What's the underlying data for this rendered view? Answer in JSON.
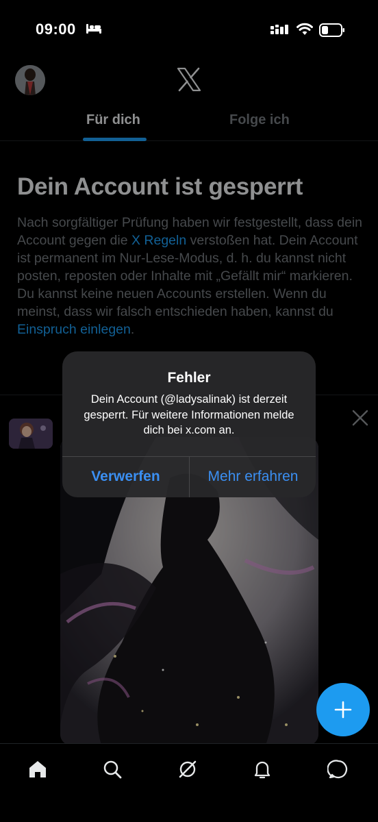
{
  "status_bar": {
    "time": "09:00",
    "sleep_icon": "bed-icon",
    "signal_icon": "cellular-signal-icon",
    "wifi_icon": "wifi-icon",
    "battery_icon": "battery-low-icon"
  },
  "header": {
    "logo_icon": "x-logo-icon",
    "tabs": [
      {
        "label": "Für dich",
        "active": true
      },
      {
        "label": "Folge ich",
        "active": false
      }
    ]
  },
  "notice": {
    "title": "Dein Account ist gesperrt",
    "body_part1": "Nach sorgfältiger Prüfung haben wir festgestellt, dass dein Account gegen die ",
    "rules_link": "X Regeln",
    "body_part2": " verstoßen hat. Dein Account ist permanent im Nur-Lese-Modus, d. h. du kannst nicht posten, reposten oder Inhalte mit „Gefällt mir“ markieren. Du kannst keine neuen Accounts erstellen. Wenn du meinst, dass wir falsch entschieden haben, kannst du ",
    "appeal_link": "Einspruch einlegen",
    "body_end": "."
  },
  "alert": {
    "title": "Fehler",
    "message": "Dein Account (@ladysalinak) ist derzeit gesperrt. Für weitere Informationen melde dich bei x.com an.",
    "dismiss_label": "Verwerfen",
    "learn_more_label": "Mehr erfahren"
  },
  "bottom_nav": {
    "items": [
      "home-icon",
      "search-icon",
      "grok-icon",
      "notifications-bell-icon",
      "messages-icon"
    ]
  },
  "colors": {
    "accent": "#1d9bf0",
    "alert_button": "#3b8ff2",
    "muted_text": "#71767b"
  }
}
